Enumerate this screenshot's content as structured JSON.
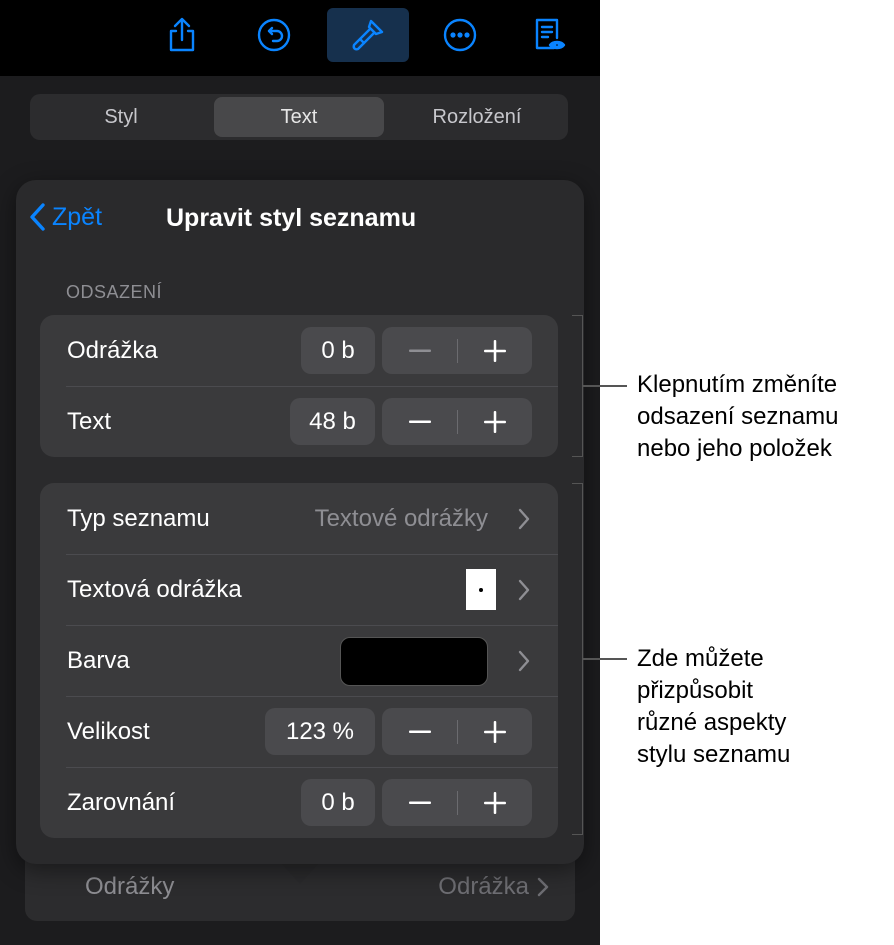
{
  "toolbar": {
    "buttons": [
      {
        "icon": "share-icon"
      },
      {
        "icon": "undo-icon"
      },
      {
        "icon": "paintbrush-icon",
        "active": true
      },
      {
        "icon": "more-icon"
      },
      {
        "icon": "reader-view-icon"
      }
    ]
  },
  "tabs": [
    "Styl",
    "Text",
    "Rozložení"
  ],
  "active_tab": "Text",
  "popover": {
    "back_label": "Zpět",
    "title": "Upravit styl seznamu",
    "section_label": "ODSAZENÍ",
    "indent_rows": [
      {
        "label": "Odrážka",
        "value": "0 b",
        "minus": "−",
        "plus": "+"
      },
      {
        "label": "Text",
        "value": "48 b",
        "minus": "−",
        "plus": "+"
      }
    ],
    "style_rows": {
      "list_type": {
        "label": "Typ seznamu",
        "value": "Textové odrážky"
      },
      "text_bullet": {
        "label": "Textová odrážka",
        "bullet": "•"
      },
      "color": {
        "label": "Barva",
        "swatch": "#000000"
      },
      "size": {
        "label": "Velikost",
        "value": "123 %",
        "minus": "−",
        "plus": "+"
      },
      "alignment": {
        "label": "Zarovnání",
        "value": "0 b",
        "minus": "−",
        "plus": "+"
      }
    }
  },
  "under_row": {
    "label": "Odrážky",
    "value": "Odrážka"
  },
  "callouts": {
    "indent": [
      "Klepnutím změníte",
      "odsazení seznamu",
      "nebo jeho položek"
    ],
    "style": [
      "Zde můžete",
      "přizpůsobit",
      "různé aspekty",
      "stylu seznamu"
    ]
  },
  "colors": {
    "accent": "#0a84ff",
    "toolbar_active": "#16304d",
    "panel": "#2a2a2c",
    "group": "#3a3a3c"
  }
}
